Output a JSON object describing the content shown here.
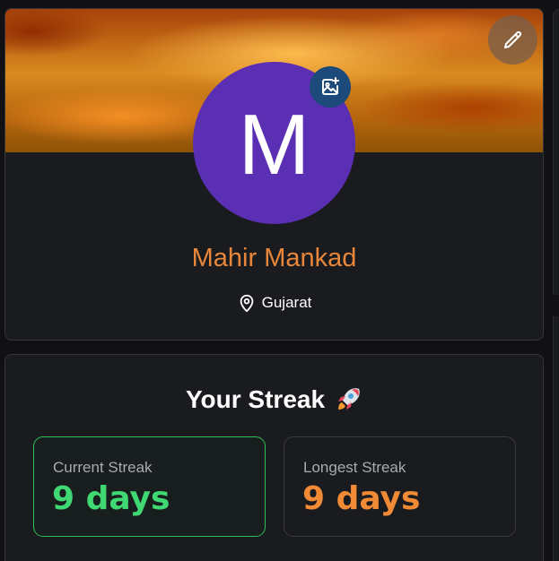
{
  "profile": {
    "avatar_letter": "M",
    "name": "Mahir Mankad",
    "location": "Gujarat",
    "icons": {
      "edit": "pencil-icon",
      "change_photo": "image-plus-icon",
      "location": "map-pin-icon"
    }
  },
  "streak": {
    "title": "Your Streak",
    "emoji": "🚀",
    "current": {
      "label": "Current Streak",
      "value": "9 days"
    },
    "longest": {
      "label": "Longest Streak",
      "value": "9 days"
    }
  },
  "colors": {
    "background": "#111114",
    "card": "#1a1b1f",
    "name_accent": "#e8873a",
    "avatar": "#5a2fb4",
    "change_photo_button": "#1c4a7a",
    "current_streak": "#3fd873",
    "longest_streak": "#f08a35"
  }
}
